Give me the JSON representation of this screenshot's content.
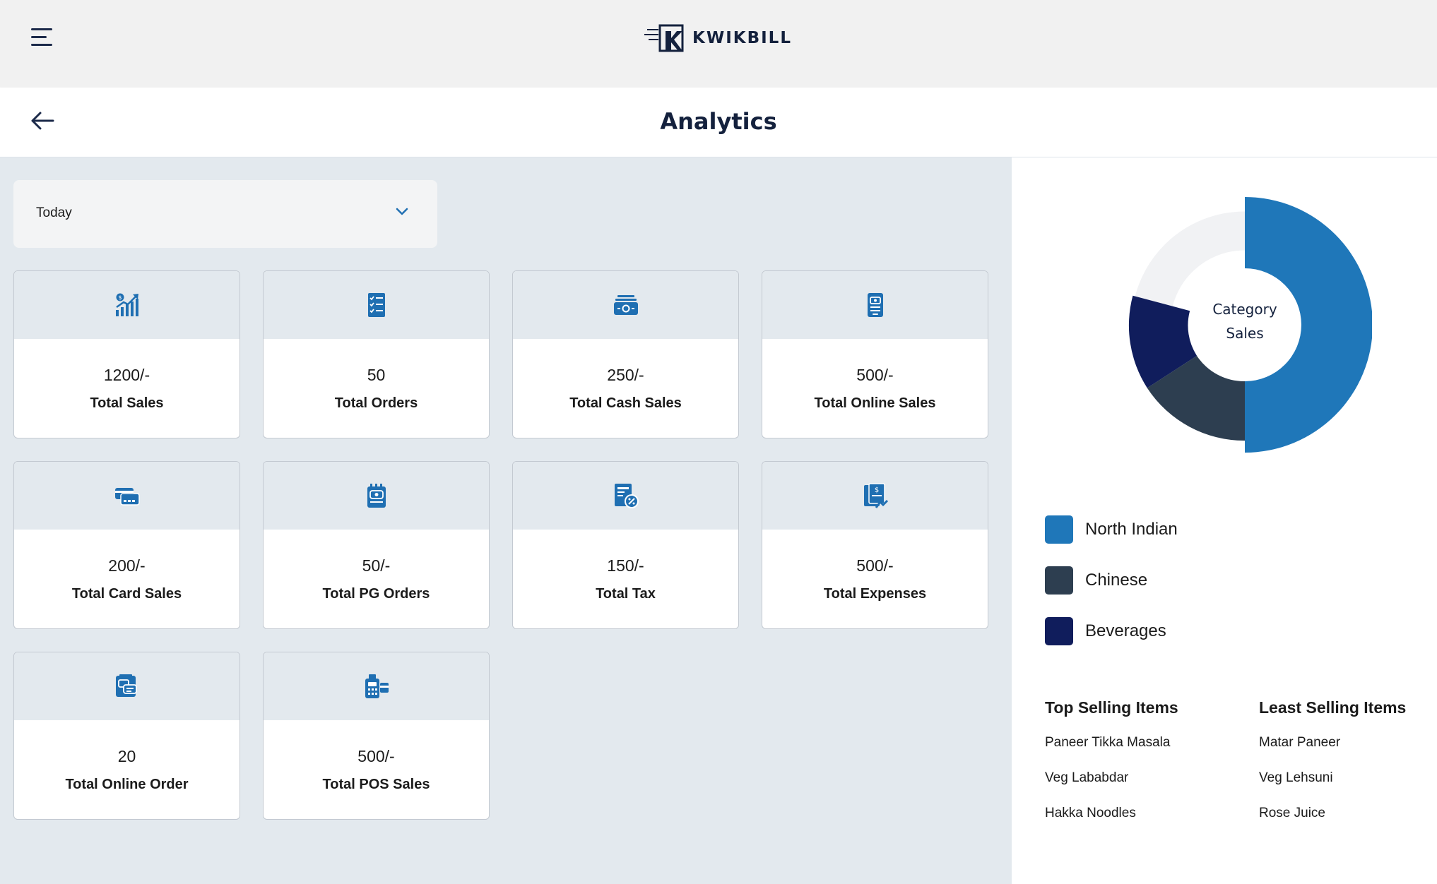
{
  "brand": {
    "name": "KWIKBILL"
  },
  "header": {
    "title": "Analytics"
  },
  "filter": {
    "selected": "Today"
  },
  "cards": [
    {
      "value": "1200/-",
      "label": "Total Sales",
      "icon": "sales-growth-icon"
    },
    {
      "value": "50",
      "label": "Total Orders",
      "icon": "checklist-icon"
    },
    {
      "value": "250/-",
      "label": "Total Cash Sales",
      "icon": "cash-icon"
    },
    {
      "value": "500/-",
      "label": "Total Online Sales",
      "icon": "mobile-payment-icon"
    },
    {
      "value": "200/-",
      "label": "Total Card Sales",
      "icon": "credit-card-icon"
    },
    {
      "value": "50/-",
      "label": "Total PG Orders",
      "icon": "payment-gateway-icon"
    },
    {
      "value": "150/-",
      "label": "Total Tax",
      "icon": "tax-receipt-icon"
    },
    {
      "value": "500/-",
      "label": "Total Expenses",
      "icon": "expense-receipt-icon"
    },
    {
      "value": "20",
      "label": "Total Online Order",
      "icon": "online-order-icon"
    },
    {
      "value": "500/-",
      "label": "Total POS Sales",
      "icon": "pos-terminal-icon"
    }
  ],
  "category_chart": {
    "center_line1": "Category",
    "center_line2": "Sales",
    "colors": {
      "North Indian": "#1f77b9",
      "Chinese": "#2d3e50",
      "Beverages": "#101d5c"
    }
  },
  "legend": [
    {
      "label": "North Indian",
      "color": "#1f77b9"
    },
    {
      "label": "Chinese",
      "color": "#2d3e50"
    },
    {
      "label": "Beverages",
      "color": "#101d5c"
    }
  ],
  "top_selling": {
    "title": "Top Selling Items",
    "items": [
      "Paneer Tikka Masala",
      "Veg Lababdar",
      "Hakka Noodles"
    ]
  },
  "least_selling": {
    "title": "Least Selling Items",
    "items": [
      "Matar Paneer",
      "Veg Lehsuni",
      "Rose Juice"
    ]
  },
  "accent_color": "#1f6fb2"
}
